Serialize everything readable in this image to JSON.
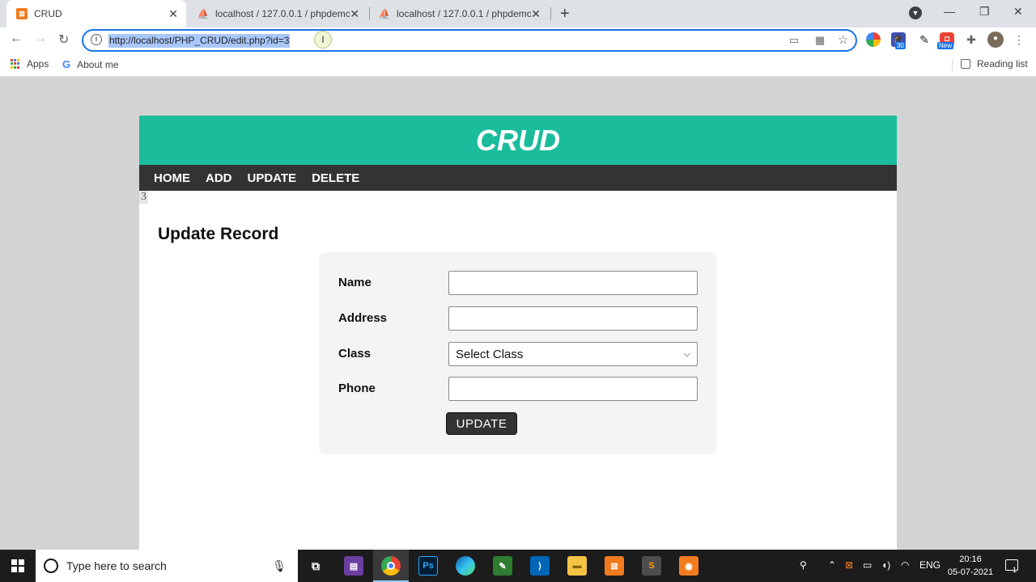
{
  "browser": {
    "tabs": [
      {
        "title": "CRUD",
        "favicon": "xampp-icon",
        "active": true
      },
      {
        "title": "localhost / 127.0.0.1 / phpdemo",
        "favicon": "phpmyadmin-icon",
        "active": false
      },
      {
        "title": "localhost / 127.0.0.1 / phpdemo",
        "favicon": "phpmyadmin-icon",
        "active": false
      }
    ],
    "new_tab": "+",
    "url": "http://localhost/PHP_CRUD/edit.php?id=3",
    "extension_badges": {
      "calendar": "30",
      "new": "New"
    },
    "bookmarks": [
      {
        "label": "Apps",
        "icon": "apps-grid-icon"
      },
      {
        "label": "About me",
        "icon": "google-icon"
      }
    ],
    "reading_list": "Reading list"
  },
  "page": {
    "header_title": "CRUD",
    "nav": [
      "HOME",
      "ADD",
      "UPDATE",
      "DELETE"
    ],
    "id_echo": "3",
    "form_title": "Update Record",
    "form": {
      "name_label": "Name",
      "name_value": "",
      "address_label": "Address",
      "address_value": "",
      "class_label": "Class",
      "class_selected": "Select Class",
      "phone_label": "Phone",
      "phone_value": "",
      "submit_label": "UPDATE"
    },
    "colors": {
      "header": "#1abc9c",
      "navbar": "#333333",
      "button": "#333333"
    }
  },
  "taskbar": {
    "search_placeholder": "Type here to search",
    "language": "ENG",
    "time": "20:16",
    "date": "05-07-2021",
    "notification_count": "1"
  }
}
